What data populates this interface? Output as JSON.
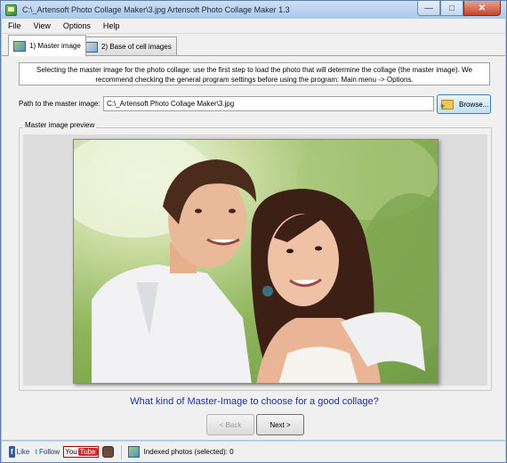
{
  "window": {
    "title": "C:\\_Artensoft Photo Collage Maker\\3.jpg Artensoft Photo Collage Maker 1.3",
    "minimize_glyph": "—",
    "maximize_glyph": "□",
    "close_glyph": "✕"
  },
  "menu": [
    "File",
    "View",
    "Options",
    "Help"
  ],
  "tabs": [
    {
      "label": "1) Master image",
      "active": true
    },
    {
      "label": "2) Base of cell images",
      "active": false
    }
  ],
  "info": {
    "line1": "Selecting the master image for the photo collage: use the first step to load the photo that will determine the collage (the master image). We",
    "line2": "recommend checking the general program settings before using the program: Main menu -> Options."
  },
  "path": {
    "label": "Path to the master image:",
    "value": "C:\\_Artensoft Photo Collage Maker\\3.jpg",
    "browse_label": "Browse..."
  },
  "preview": {
    "legend": "Master image preview"
  },
  "help_link": "What kind of Master-Image to choose for a good collage?",
  "nav": {
    "back_label": "< Back",
    "next_label": "Next >"
  },
  "statusbar": {
    "fb_badge": "f",
    "fb_label": "Like",
    "tw_badge": "t",
    "tw_label": "Follow",
    "yt_left": "You",
    "yt_right": "Tube",
    "indexed_text": "Indexed photos (selected): 0"
  },
  "colors": {
    "link": "#1a2fa8",
    "titlebar": "#a9c8ea"
  }
}
